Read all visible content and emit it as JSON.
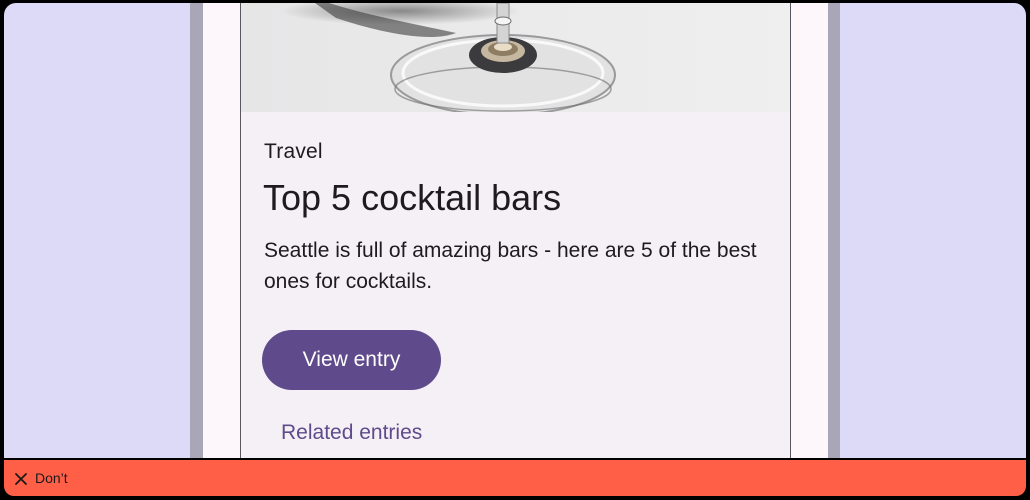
{
  "card": {
    "overline": "Travel",
    "headline": "Top 5 cocktail bars",
    "body": "Seattle is full of amazing bars - here are 5 of the best ones for cocktails.",
    "media_icon": "cocktail-glass-photo"
  },
  "actions": {
    "primary_label": "View entry",
    "secondary_label": "Related entries"
  },
  "banner": {
    "icon": "close-icon",
    "label": "Don’t"
  },
  "colors": {
    "background": "#dcdaf7",
    "card_surface": "#f5f0f6",
    "primary": "#5f4b8b",
    "banner": "#ff5f46",
    "text": "#1d1b20"
  }
}
